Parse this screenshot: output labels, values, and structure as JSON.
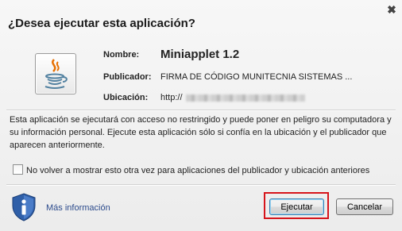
{
  "dialog": {
    "title": "¿Desea ejecutar esta aplicación?",
    "close_glyph": "✖"
  },
  "app": {
    "icon": "java-icon",
    "name_label": "Nombre:",
    "name_value": "Miniapplet 1.2",
    "publisher_label": "Publicador:",
    "publisher_value": "FIRMA DE CÓDIGO MUNITECNIA SISTEMAS  ...",
    "location_label": "Ubicación:",
    "location_value": "http://"
  },
  "warning_text": "Esta aplicación se ejecutará con acceso no restringido y puede poner en peligro su computadora y su información personal. Ejecute esta aplicación sólo si confía en la ubicación y el publicador que aparecen anteriormente.",
  "checkbox": {
    "label": "No volver a mostrar esto otra vez para aplicaciones del publicador y ubicación anteriores",
    "checked": false
  },
  "footer": {
    "info_icon": "shield-info-icon",
    "more_info": "Más información",
    "run_button": "Ejecutar",
    "cancel_button": "Cancelar",
    "highlight_color": "#d6141b"
  }
}
